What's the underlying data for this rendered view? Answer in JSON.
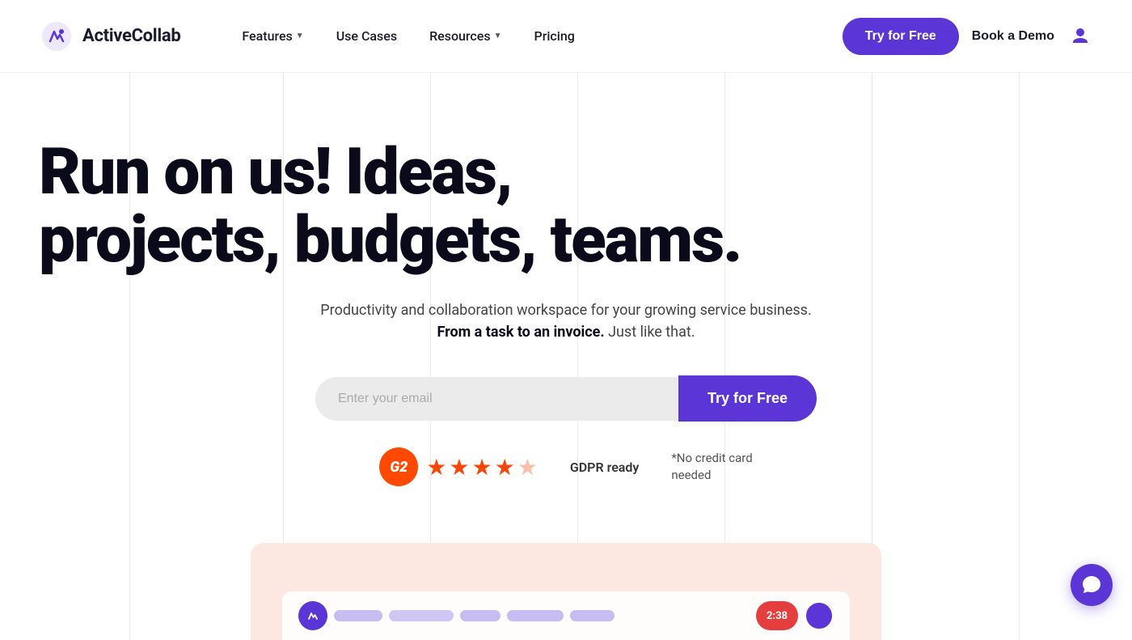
{
  "brand": {
    "name": "ActiveCollab",
    "logo_alt": "ActiveCollab logo"
  },
  "nav": {
    "links": [
      {
        "label": "Features",
        "has_dropdown": true
      },
      {
        "label": "Use Cases",
        "has_dropdown": false
      },
      {
        "label": "Resources",
        "has_dropdown": true
      },
      {
        "label": "Pricing",
        "has_dropdown": false
      }
    ],
    "try_free_label": "Try for Free",
    "book_demo_label": "Book a Demo"
  },
  "hero": {
    "title": "Run on us! Ideas, projects, budgets, teams.",
    "subtitle_normal": "Productivity and collaboration workspace for your growing service business.",
    "subtitle_bold": "From a task to an invoice.",
    "subtitle_end": " Just like that.",
    "email_placeholder": "Enter your email",
    "try_free_label": "Try for Free",
    "g2_label": "G2",
    "stars": [
      1,
      1,
      1,
      1,
      0.5
    ],
    "gdpr_label": "GDPR ready",
    "no_cc_line1": "*No credit card",
    "no_cc_line2": "needed"
  },
  "chat": {
    "label": "Chat support"
  },
  "colors": {
    "accent": "#5b35d5",
    "star": "#f5470a",
    "g2_bg": "#ff4800"
  }
}
